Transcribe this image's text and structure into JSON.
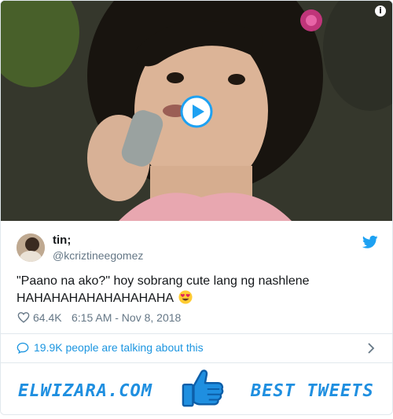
{
  "tweet": {
    "author_name": "tin;",
    "author_handle": "@kcriztineegomez",
    "text": "\"Paano na ako?\" hoy sobrang cute lang ng nashlene HAHAHAHAHAHAHAHAHA",
    "emoji": "heart-eyes-emoji",
    "likes": "64.4K",
    "timestamp": "6:15 AM - Nov 8, 2018"
  },
  "media": {
    "info_label": "i",
    "play_icon": "play-icon"
  },
  "talking": {
    "label": "19.9K people are talking about this"
  },
  "banner": {
    "left_text": "ELWIZARA.COM",
    "right_text": "BEST TWEETS",
    "icon": "thumbs-up-icon"
  },
  "colors": {
    "twitter_blue": "#1da1f2",
    "link_blue": "#1b95e0",
    "brand_blue": "#1f8fe0",
    "muted_gray": "#657786",
    "border": "#e1e8ed"
  }
}
